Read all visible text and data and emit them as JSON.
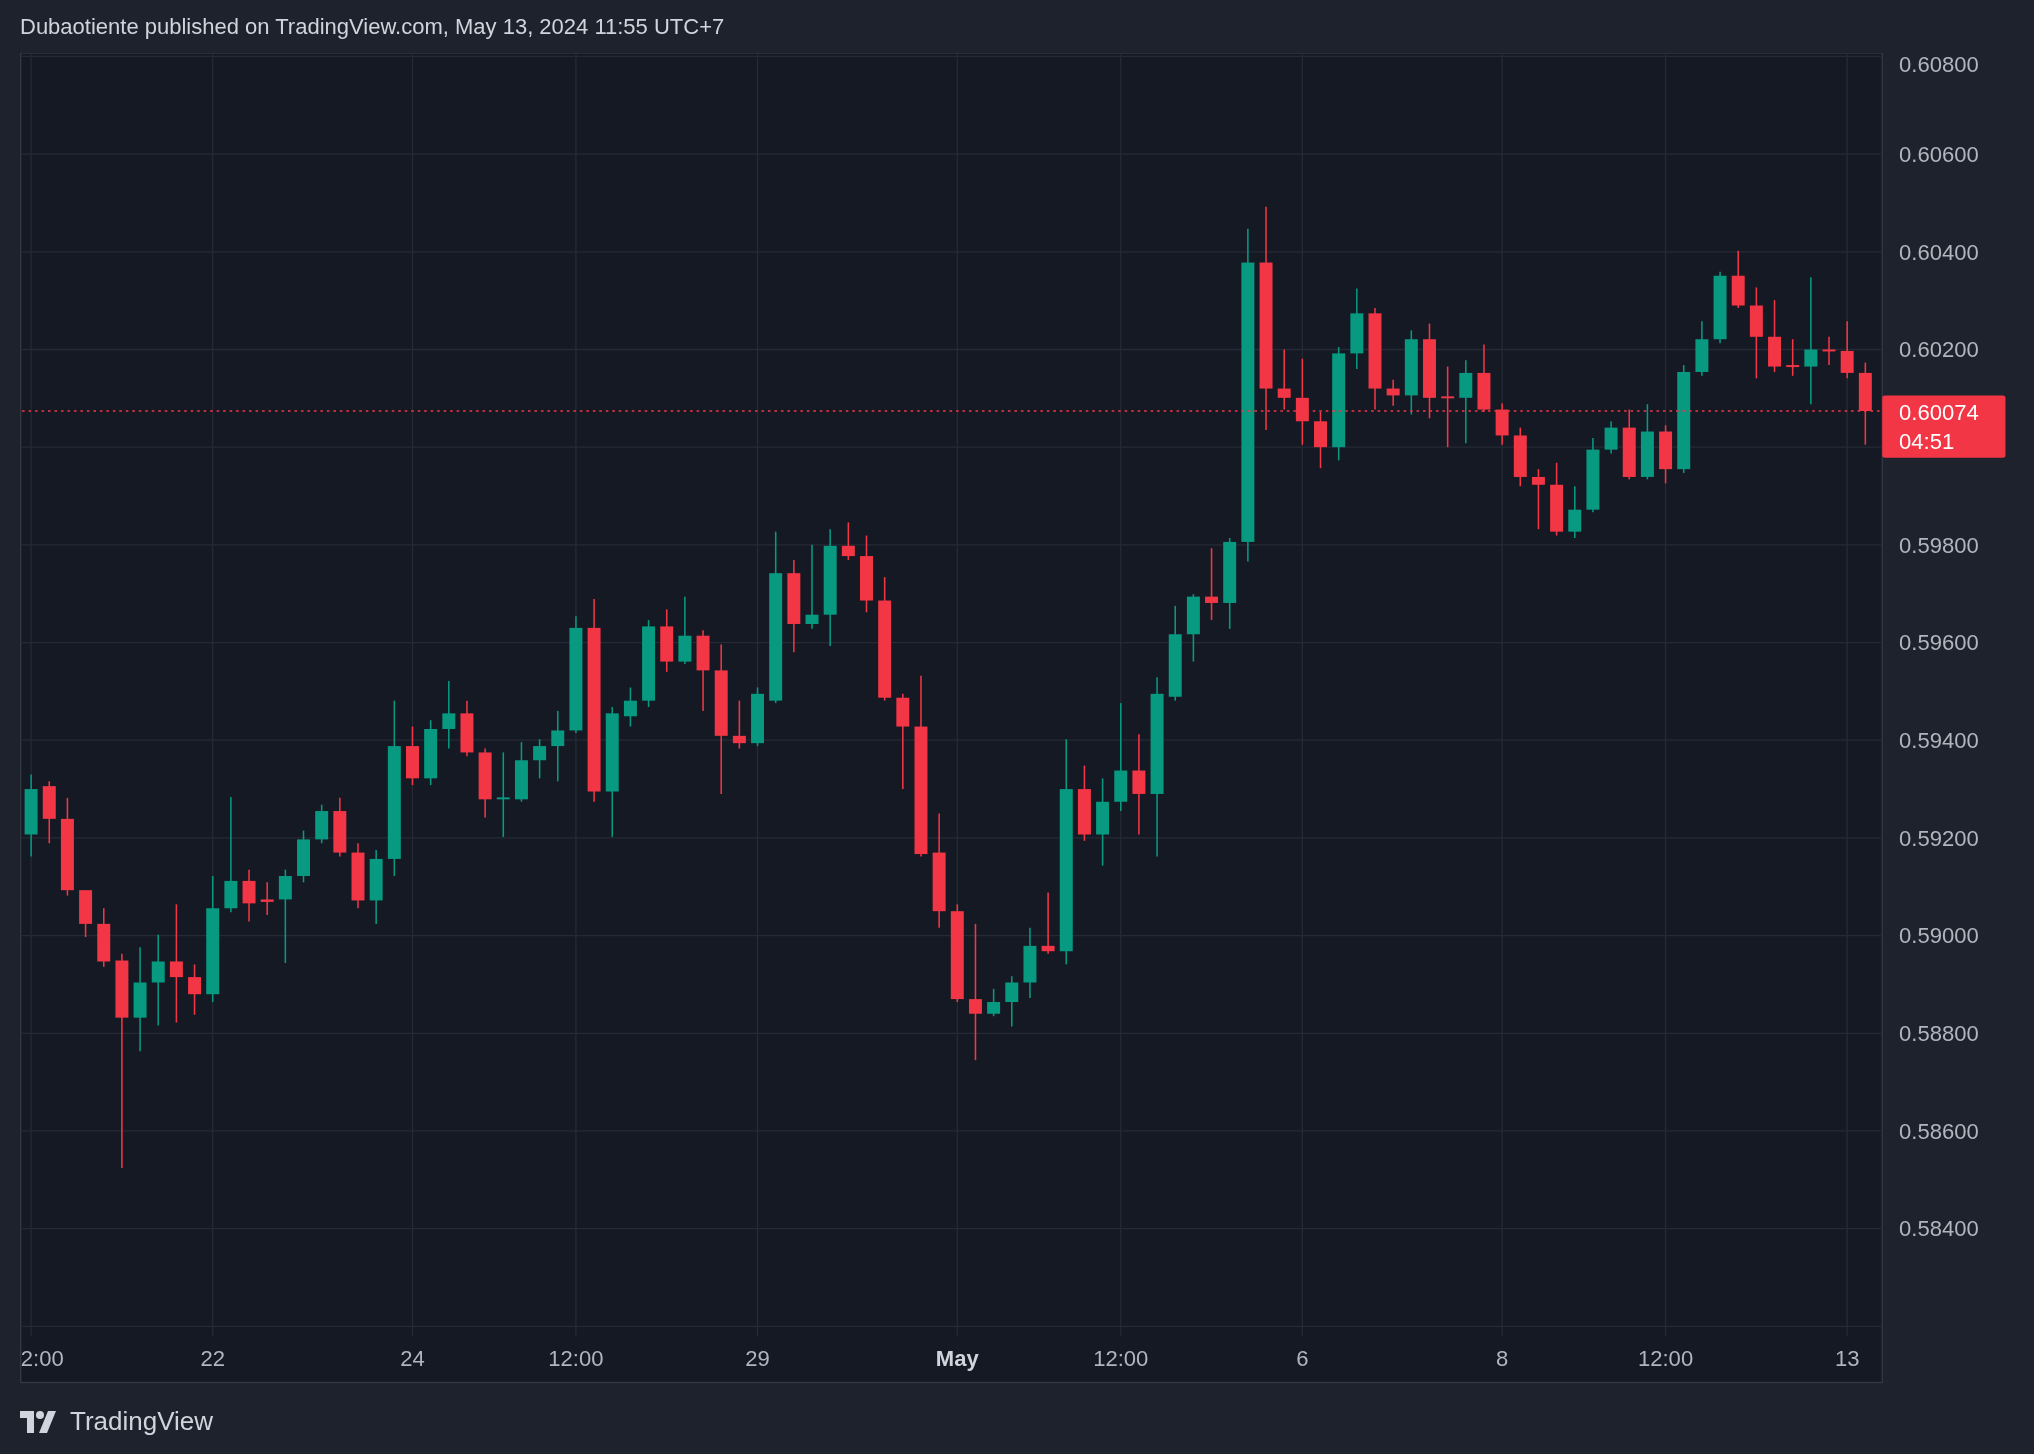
{
  "caption": "Dubaotiente published on TradingView.com, May 13, 2024 11:55 UTC+7",
  "chart": {
    "chart_data": {
      "type": "candlestick",
      "categories": [
        "2:00",
        null,
        null,
        null,
        null,
        null,
        null,
        null,
        null,
        null,
        "22",
        null,
        null,
        null,
        null,
        null,
        null,
        null,
        null,
        null,
        null,
        "24",
        null,
        null,
        null,
        null,
        null,
        null,
        null,
        null,
        "12:00",
        null,
        null,
        null,
        null,
        null,
        null,
        null,
        null,
        null,
        "29",
        null,
        null,
        null,
        null,
        null,
        null,
        null,
        null,
        null,
        null,
        "May",
        null,
        null,
        null,
        null,
        null,
        null,
        null,
        null,
        "12:00",
        null,
        null,
        null,
        null,
        null,
        null,
        null,
        null,
        null,
        "6",
        null,
        null,
        null,
        null,
        null,
        null,
        null,
        null,
        null,
        null,
        "8",
        null,
        null,
        null,
        null,
        null,
        null,
        null,
        null,
        "12:00",
        null,
        null,
        null,
        null,
        null,
        null,
        null,
        null,
        null,
        "13",
        null
      ],
      "grid": true,
      "ref_lines": [
        {
          "axis": "y",
          "value": 0.60074,
          "color": "#f23645"
        }
      ],
      "ylim": [
        0.58085,
        0.60807
      ],
      "ohlc": [
        [
          0.59207,
          0.5933,
          0.59162,
          0.593
        ],
        [
          0.59306,
          0.59316,
          0.59189,
          0.59239
        ],
        [
          0.59239,
          0.59282,
          0.59082,
          0.59093
        ],
        [
          0.59093,
          0.59093,
          0.58997,
          0.59024
        ],
        [
          0.59024,
          0.59056,
          0.58936,
          0.58947
        ],
        [
          0.58949,
          0.58963,
          0.58524,
          0.58832
        ],
        [
          0.58832,
          0.58976,
          0.58763,
          0.58904
        ],
        [
          0.58904,
          0.59002,
          0.58816,
          0.58947
        ],
        [
          0.58947,
          0.59064,
          0.58822,
          0.58915
        ],
        [
          0.58915,
          0.58941,
          0.58838,
          0.5888
        ],
        [
          0.5888,
          0.59122,
          0.58864,
          0.59056
        ],
        [
          0.59056,
          0.59284,
          0.59048,
          0.59112
        ],
        [
          0.59112,
          0.59135,
          0.59029,
          0.59066
        ],
        [
          0.59074,
          0.59109,
          0.59042,
          0.59069
        ],
        [
          0.59074,
          0.59135,
          0.58944,
          0.59122
        ],
        [
          0.59122,
          0.59215,
          0.59109,
          0.59197
        ],
        [
          0.59197,
          0.59268,
          0.59189,
          0.59255
        ],
        [
          0.59255,
          0.59282,
          0.59162,
          0.5917
        ],
        [
          0.5917,
          0.59189,
          0.59056,
          0.59072
        ],
        [
          0.59072,
          0.59175,
          0.59024,
          0.59157
        ],
        [
          0.59157,
          0.59481,
          0.59122,
          0.59388
        ],
        [
          0.59388,
          0.59428,
          0.59308,
          0.59322
        ],
        [
          0.59322,
          0.59441,
          0.59308,
          0.59423
        ],
        [
          0.59423,
          0.59521,
          0.59383,
          0.59455
        ],
        [
          0.59455,
          0.59481,
          0.59367,
          0.59375
        ],
        [
          0.59375,
          0.59383,
          0.59242,
          0.59279
        ],
        [
          0.59282,
          0.59375,
          0.59202,
          0.59283
        ],
        [
          0.59279,
          0.59396,
          0.59274,
          0.59359
        ],
        [
          0.59359,
          0.59402,
          0.59322,
          0.59388
        ],
        [
          0.59388,
          0.5946,
          0.59316,
          0.5942
        ],
        [
          0.5942,
          0.59654,
          0.59415,
          0.5963
        ],
        [
          0.5963,
          0.59689,
          0.59274,
          0.59295
        ],
        [
          0.59295,
          0.59468,
          0.59202,
          0.59455
        ],
        [
          0.59449,
          0.59508,
          0.59428,
          0.59481
        ],
        [
          0.59481,
          0.59646,
          0.59468,
          0.59633
        ],
        [
          0.59633,
          0.59668,
          0.5954,
          0.59561
        ],
        [
          0.59561,
          0.59694,
          0.59556,
          0.59614
        ],
        [
          0.59614,
          0.59625,
          0.5946,
          0.59543
        ],
        [
          0.59543,
          0.59596,
          0.5929,
          0.59409
        ],
        [
          0.59409,
          0.59481,
          0.59383,
          0.59394
        ],
        [
          0.59394,
          0.59508,
          0.59388,
          0.59495
        ],
        [
          0.59481,
          0.59827,
          0.59476,
          0.59742
        ],
        [
          0.59742,
          0.59769,
          0.5958,
          0.59638
        ],
        [
          0.59638,
          0.598,
          0.59628,
          0.59657
        ],
        [
          0.59657,
          0.59832,
          0.59593,
          0.59798
        ],
        [
          0.59798,
          0.59846,
          0.59769,
          0.59777
        ],
        [
          0.59777,
          0.59819,
          0.59662,
          0.59686
        ],
        [
          0.59686,
          0.59734,
          0.59481,
          0.59487
        ],
        [
          0.59487,
          0.59495,
          0.593,
          0.59428
        ],
        [
          0.59428,
          0.59532,
          0.59162,
          0.59167
        ],
        [
          0.5917,
          0.5925,
          0.59016,
          0.5905
        ],
        [
          0.5905,
          0.59064,
          0.58864,
          0.5887
        ],
        [
          0.5887,
          0.59024,
          0.58745,
          0.5884
        ],
        [
          0.5884,
          0.58891,
          0.58835,
          0.58864
        ],
        [
          0.58864,
          0.58917,
          0.58814,
          0.58904
        ],
        [
          0.58904,
          0.59016,
          0.58872,
          0.58979
        ],
        [
          0.58979,
          0.59088,
          0.58963,
          0.58968
        ],
        [
          0.58968,
          0.59402,
          0.58941,
          0.593
        ],
        [
          0.593,
          0.59348,
          0.59194,
          0.59207
        ],
        [
          0.59207,
          0.59322,
          0.59143,
          0.59274
        ],
        [
          0.59274,
          0.59476,
          0.59255,
          0.59338
        ],
        [
          0.59338,
          0.59412,
          0.59207,
          0.5929
        ],
        [
          0.5929,
          0.59529,
          0.59162,
          0.59495
        ],
        [
          0.59489,
          0.59675,
          0.59481,
          0.59617
        ],
        [
          0.59617,
          0.59699,
          0.59561,
          0.59694
        ],
        [
          0.59694,
          0.59793,
          0.59646,
          0.59681
        ],
        [
          0.59681,
          0.59814,
          0.59628,
          0.59806
        ],
        [
          0.59806,
          0.60447,
          0.59766,
          0.60378
        ],
        [
          0.60378,
          0.60492,
          0.60035,
          0.6012
        ],
        [
          0.6012,
          0.602,
          0.60077,
          0.60101
        ],
        [
          0.60101,
          0.60181,
          0.60005,
          0.60053
        ],
        [
          0.60053,
          0.60072,
          0.59957,
          0.6
        ],
        [
          0.6,
          0.60205,
          0.59973,
          0.60192
        ],
        [
          0.60192,
          0.60325,
          0.6016,
          0.60274
        ],
        [
          0.60274,
          0.60285,
          0.60077,
          0.6012
        ],
        [
          0.6012,
          0.60138,
          0.60085,
          0.60106
        ],
        [
          0.60106,
          0.60239,
          0.60067,
          0.60221
        ],
        [
          0.60221,
          0.60253,
          0.60059,
          0.60101
        ],
        [
          0.60104,
          0.60165,
          0.6,
          0.60101
        ],
        [
          0.60101,
          0.60178,
          0.60008,
          0.60152
        ],
        [
          0.60152,
          0.6021,
          0.60072,
          0.60077
        ],
        [
          0.60077,
          0.6009,
          0.60005,
          0.60024
        ],
        [
          0.60024,
          0.6004,
          0.5992,
          0.59939
        ],
        [
          0.59939,
          0.59955,
          0.59832,
          0.59923
        ],
        [
          0.59923,
          0.59968,
          0.59819,
          0.59827
        ],
        [
          0.59827,
          0.5992,
          0.59814,
          0.59872
        ],
        [
          0.59872,
          0.60019,
          0.59867,
          0.59995
        ],
        [
          0.59995,
          0.60053,
          0.59987,
          0.6004
        ],
        [
          0.6004,
          0.60077,
          0.59934,
          0.59939
        ],
        [
          0.59939,
          0.60088,
          0.59934,
          0.60032
        ],
        [
          0.60032,
          0.60045,
          0.59926,
          0.59955
        ],
        [
          0.59955,
          0.60168,
          0.59947,
          0.60154
        ],
        [
          0.60154,
          0.60258,
          0.60146,
          0.60221
        ],
        [
          0.60221,
          0.60359,
          0.60213,
          0.60351
        ],
        [
          0.60351,
          0.60402,
          0.60285,
          0.6029
        ],
        [
          0.6029,
          0.60327,
          0.60141,
          0.60226
        ],
        [
          0.60226,
          0.60301,
          0.60154,
          0.60165
        ],
        [
          0.60168,
          0.60221,
          0.60146,
          0.60165
        ],
        [
          0.60165,
          0.60348,
          0.60088,
          0.602
        ],
        [
          0.602,
          0.60226,
          0.60168,
          0.60197
        ],
        [
          0.60197,
          0.60258,
          0.60141,
          0.60152
        ],
        [
          0.60152,
          0.60173,
          0.60005,
          0.60074
        ]
      ],
      "yticks": [
        {
          "value": 0.608,
          "label": "0.60800"
        },
        {
          "value": 0.606,
          "label": "0.60600"
        },
        {
          "value": 0.604,
          "label": "0.60400"
        },
        {
          "value": 0.602,
          "label": "0.60200"
        },
        {
          "value": 0.598,
          "label": "0.59800"
        },
        {
          "value": 0.596,
          "label": "0.59600"
        },
        {
          "value": 0.594,
          "label": "0.59400"
        },
        {
          "value": 0.592,
          "label": "0.59200"
        },
        {
          "value": 0.59,
          "label": "0.59000"
        },
        {
          "value": 0.588,
          "label": "0.58800"
        },
        {
          "value": 0.586,
          "label": "0.58600"
        },
        {
          "value": 0.584,
          "label": "0.58400"
        }
      ]
    },
    "time_labels_bold": [
      false,
      false,
      false,
      false,
      false,
      true,
      false,
      false,
      false,
      false,
      false
    ],
    "current_price": {
      "price": "0.60074",
      "countdown": "04:51"
    }
  },
  "footer": {
    "brand": "TradingView"
  }
}
